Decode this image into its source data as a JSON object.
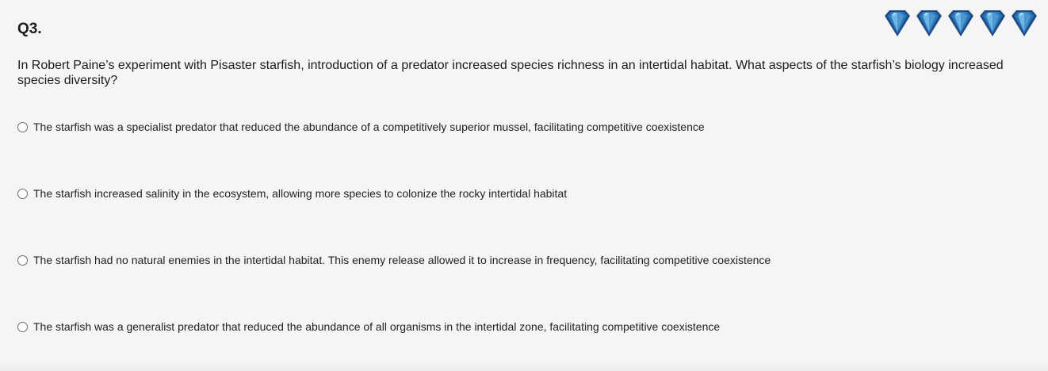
{
  "question": {
    "number": "Q3.",
    "text": "In Robert Paine’s experiment with Pisaster starfish, introduction of a predator increased species richness in an intertidal habitat. What aspects of the starfish’s biology increased species diversity?",
    "options": [
      {
        "label": "The starfish was a specialist predator that reduced the abundance of a competitively superior mussel, facilitating competitive coexistence",
        "selected": false
      },
      {
        "label": "The starfish increased salinity in the ecosystem, allowing more species to colonize the rocky intertidal habitat",
        "selected": false
      },
      {
        "label": "The starfish had no natural enemies in the intertidal habitat. This enemy release allowed it to increase in frequency, facilitating competitive coexistence",
        "selected": false
      },
      {
        "label": "The starfish was a generalist predator that reduced the abundance of all organisms in the intertidal zone, facilitating competitive coexistence",
        "selected": false
      }
    ]
  },
  "difficulty": {
    "icon": "diamond-icon",
    "count": 5,
    "colors": {
      "dark": "#1d4f86",
      "mid": "#2f77b8",
      "light": "#6fb6e6",
      "highlight": "#a9dbf7"
    }
  }
}
